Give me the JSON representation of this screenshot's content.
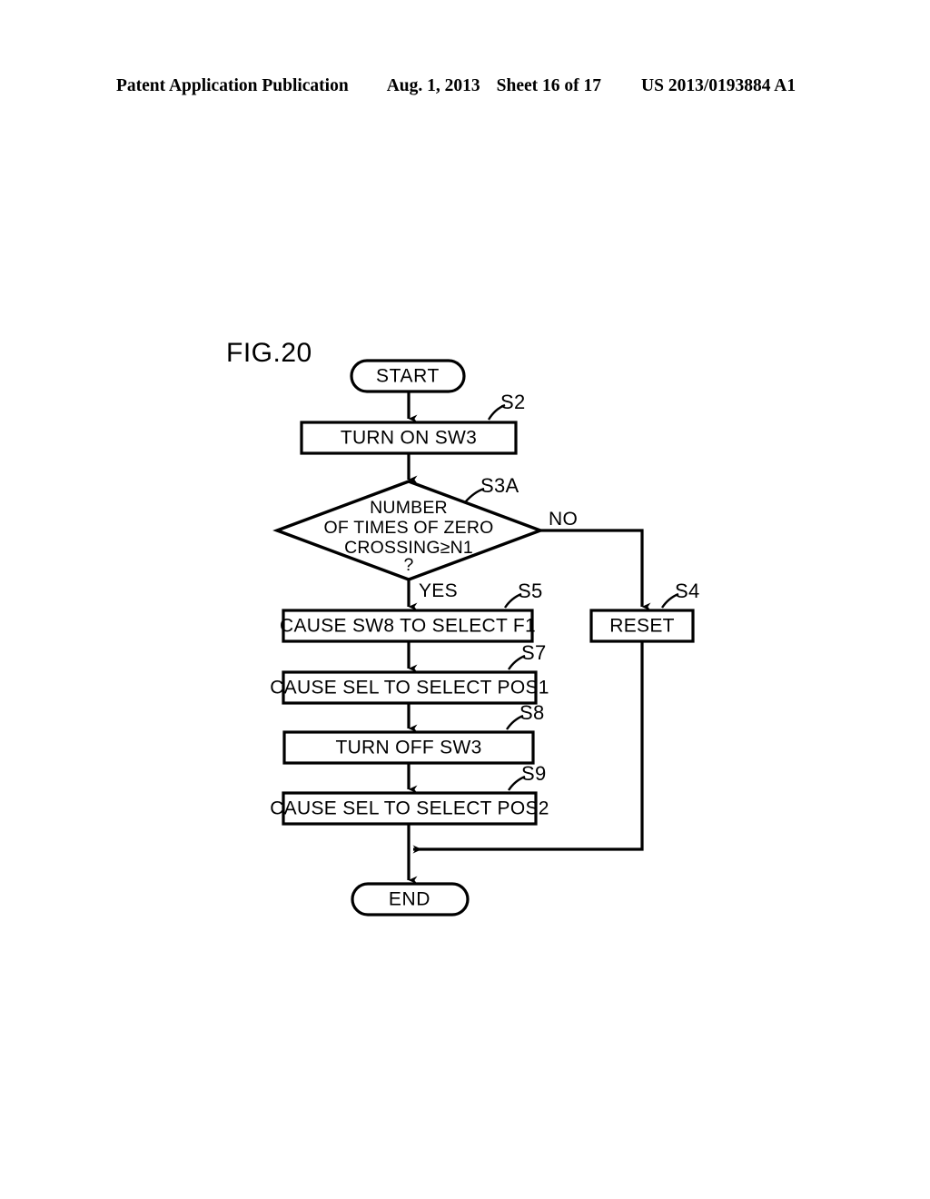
{
  "header": {
    "publication": "Patent Application Publication",
    "date": "Aug. 1, 2013",
    "sheet": "Sheet 16 of 17",
    "patent_number": "US 2013/0193884 A1"
  },
  "figure": {
    "label": "FIG.20"
  },
  "flowchart": {
    "nodes": {
      "start": {
        "text": "START",
        "type": "terminator"
      },
      "s2": {
        "text": "TURN ON SW3",
        "type": "process",
        "step": "S2"
      },
      "s3a": {
        "line1": "NUMBER",
        "line2": "OF TIMES OF ZERO",
        "line3": "CROSSING≥N1",
        "line4": "?",
        "type": "decision",
        "step": "S3A"
      },
      "s5": {
        "text": "CAUSE SW8 TO SELECT F1",
        "type": "process",
        "step": "S5"
      },
      "s7": {
        "text": "CAUSE SEL TO SELECT POS1",
        "type": "process",
        "step": "S7"
      },
      "s8": {
        "text": "TURN OFF SW3",
        "type": "process",
        "step": "S8"
      },
      "s9": {
        "text": "CAUSE SEL TO SELECT POS2",
        "type": "process",
        "step": "S9"
      },
      "s4": {
        "text": "RESET",
        "type": "process",
        "step": "S4"
      },
      "end": {
        "text": "END",
        "type": "terminator"
      }
    },
    "branches": {
      "yes": "YES",
      "no": "NO"
    },
    "colors": {
      "stroke": "#000000",
      "fill": "#ffffff",
      "background": "#ffffff"
    }
  }
}
